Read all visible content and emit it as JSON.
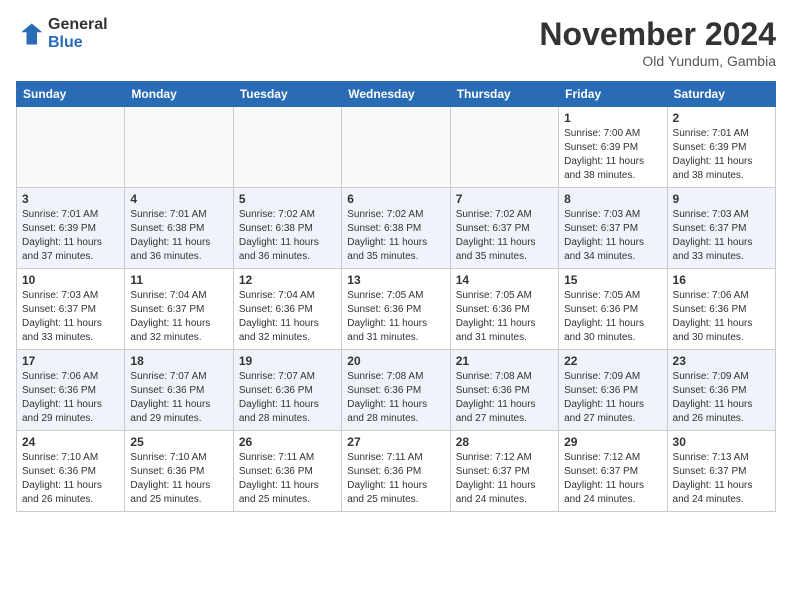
{
  "header": {
    "logo_line1": "General",
    "logo_line2": "Blue",
    "month": "November 2024",
    "location": "Old Yundum, Gambia"
  },
  "weekdays": [
    "Sunday",
    "Monday",
    "Tuesday",
    "Wednesday",
    "Thursday",
    "Friday",
    "Saturday"
  ],
  "weeks": [
    [
      {
        "day": "",
        "info": ""
      },
      {
        "day": "",
        "info": ""
      },
      {
        "day": "",
        "info": ""
      },
      {
        "day": "",
        "info": ""
      },
      {
        "day": "",
        "info": ""
      },
      {
        "day": "1",
        "info": "Sunrise: 7:00 AM\nSunset: 6:39 PM\nDaylight: 11 hours and 38 minutes."
      },
      {
        "day": "2",
        "info": "Sunrise: 7:01 AM\nSunset: 6:39 PM\nDaylight: 11 hours and 38 minutes."
      }
    ],
    [
      {
        "day": "3",
        "info": "Sunrise: 7:01 AM\nSunset: 6:39 PM\nDaylight: 11 hours and 37 minutes."
      },
      {
        "day": "4",
        "info": "Sunrise: 7:01 AM\nSunset: 6:38 PM\nDaylight: 11 hours and 36 minutes."
      },
      {
        "day": "5",
        "info": "Sunrise: 7:02 AM\nSunset: 6:38 PM\nDaylight: 11 hours and 36 minutes."
      },
      {
        "day": "6",
        "info": "Sunrise: 7:02 AM\nSunset: 6:38 PM\nDaylight: 11 hours and 35 minutes."
      },
      {
        "day": "7",
        "info": "Sunrise: 7:02 AM\nSunset: 6:37 PM\nDaylight: 11 hours and 35 minutes."
      },
      {
        "day": "8",
        "info": "Sunrise: 7:03 AM\nSunset: 6:37 PM\nDaylight: 11 hours and 34 minutes."
      },
      {
        "day": "9",
        "info": "Sunrise: 7:03 AM\nSunset: 6:37 PM\nDaylight: 11 hours and 33 minutes."
      }
    ],
    [
      {
        "day": "10",
        "info": "Sunrise: 7:03 AM\nSunset: 6:37 PM\nDaylight: 11 hours and 33 minutes."
      },
      {
        "day": "11",
        "info": "Sunrise: 7:04 AM\nSunset: 6:37 PM\nDaylight: 11 hours and 32 minutes."
      },
      {
        "day": "12",
        "info": "Sunrise: 7:04 AM\nSunset: 6:36 PM\nDaylight: 11 hours and 32 minutes."
      },
      {
        "day": "13",
        "info": "Sunrise: 7:05 AM\nSunset: 6:36 PM\nDaylight: 11 hours and 31 minutes."
      },
      {
        "day": "14",
        "info": "Sunrise: 7:05 AM\nSunset: 6:36 PM\nDaylight: 11 hours and 31 minutes."
      },
      {
        "day": "15",
        "info": "Sunrise: 7:05 AM\nSunset: 6:36 PM\nDaylight: 11 hours and 30 minutes."
      },
      {
        "day": "16",
        "info": "Sunrise: 7:06 AM\nSunset: 6:36 PM\nDaylight: 11 hours and 30 minutes."
      }
    ],
    [
      {
        "day": "17",
        "info": "Sunrise: 7:06 AM\nSunset: 6:36 PM\nDaylight: 11 hours and 29 minutes."
      },
      {
        "day": "18",
        "info": "Sunrise: 7:07 AM\nSunset: 6:36 PM\nDaylight: 11 hours and 29 minutes."
      },
      {
        "day": "19",
        "info": "Sunrise: 7:07 AM\nSunset: 6:36 PM\nDaylight: 11 hours and 28 minutes."
      },
      {
        "day": "20",
        "info": "Sunrise: 7:08 AM\nSunset: 6:36 PM\nDaylight: 11 hours and 28 minutes."
      },
      {
        "day": "21",
        "info": "Sunrise: 7:08 AM\nSunset: 6:36 PM\nDaylight: 11 hours and 27 minutes."
      },
      {
        "day": "22",
        "info": "Sunrise: 7:09 AM\nSunset: 6:36 PM\nDaylight: 11 hours and 27 minutes."
      },
      {
        "day": "23",
        "info": "Sunrise: 7:09 AM\nSunset: 6:36 PM\nDaylight: 11 hours and 26 minutes."
      }
    ],
    [
      {
        "day": "24",
        "info": "Sunrise: 7:10 AM\nSunset: 6:36 PM\nDaylight: 11 hours and 26 minutes."
      },
      {
        "day": "25",
        "info": "Sunrise: 7:10 AM\nSunset: 6:36 PM\nDaylight: 11 hours and 25 minutes."
      },
      {
        "day": "26",
        "info": "Sunrise: 7:11 AM\nSunset: 6:36 PM\nDaylight: 11 hours and 25 minutes."
      },
      {
        "day": "27",
        "info": "Sunrise: 7:11 AM\nSunset: 6:36 PM\nDaylight: 11 hours and 25 minutes."
      },
      {
        "day": "28",
        "info": "Sunrise: 7:12 AM\nSunset: 6:37 PM\nDaylight: 11 hours and 24 minutes."
      },
      {
        "day": "29",
        "info": "Sunrise: 7:12 AM\nSunset: 6:37 PM\nDaylight: 11 hours and 24 minutes."
      },
      {
        "day": "30",
        "info": "Sunrise: 7:13 AM\nSunset: 6:37 PM\nDaylight: 11 hours and 24 minutes."
      }
    ]
  ]
}
